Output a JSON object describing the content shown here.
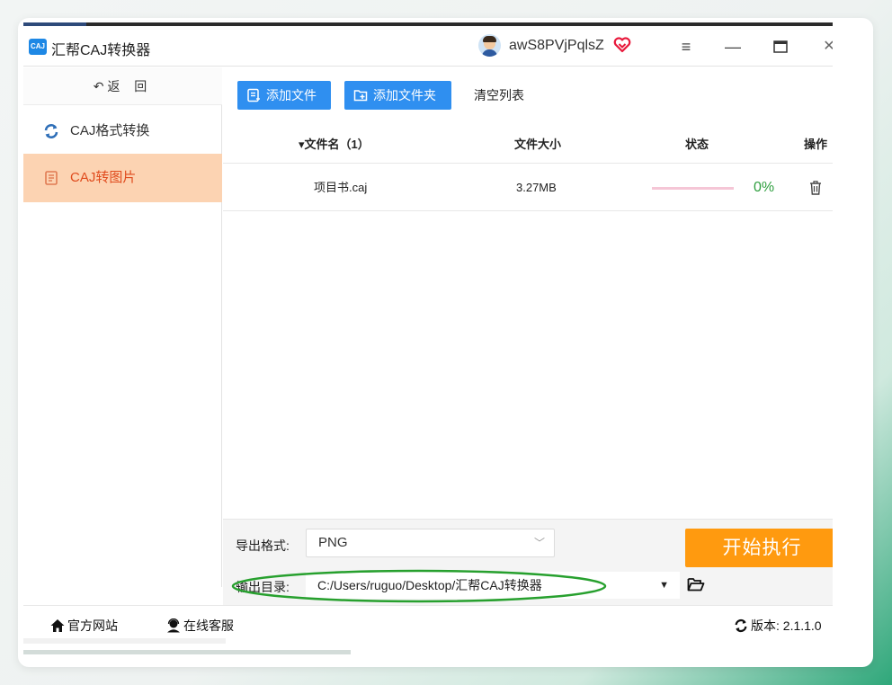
{
  "window": {
    "title": "汇帮CAJ转换器",
    "app_icon_text": "CAJ",
    "username": "awS8PVjPqlsZ",
    "menu_glyph": "≡",
    "minimize_glyph": "—",
    "maximize_glyph": "□",
    "close_glyph": "✕"
  },
  "sidebar": {
    "back_label": "返 回",
    "items": [
      {
        "label": "CAJ格式转换",
        "icon": "refresh-icon",
        "active": false
      },
      {
        "label": "CAJ转图片",
        "icon": "document-icon",
        "active": true
      }
    ]
  },
  "toolbar": {
    "add_file_label": "添加文件",
    "add_folder_label": "添加文件夹",
    "clear_list_label": "清空列表"
  },
  "table": {
    "headers": {
      "name": "▾文件名（1）",
      "size": "文件大小",
      "status": "状态",
      "operation": "操作"
    },
    "rows": [
      {
        "name": "项目书.caj",
        "size": "3.27MB",
        "progress_percent": 0,
        "progress_label": "0%"
      }
    ]
  },
  "settings": {
    "format_label": "导出格式:",
    "format_value": "PNG",
    "output_label": "输出目录:",
    "output_path": "C:/Users/ruguo/Desktop/汇帮CAJ转换器",
    "start_label": "开始执行"
  },
  "footer": {
    "official_site": "官方网站",
    "online_service": "在线客服",
    "version": "版本: 2.1.1.0"
  },
  "colors": {
    "primary_blue": "#2f8ff0",
    "active_nav_bg": "#fcd3b2",
    "active_nav_text": "#e04b1d",
    "start_button": "#ff9a0f",
    "progress_green": "#2e9e3e",
    "highlight_ellipse": "#27a02e"
  }
}
